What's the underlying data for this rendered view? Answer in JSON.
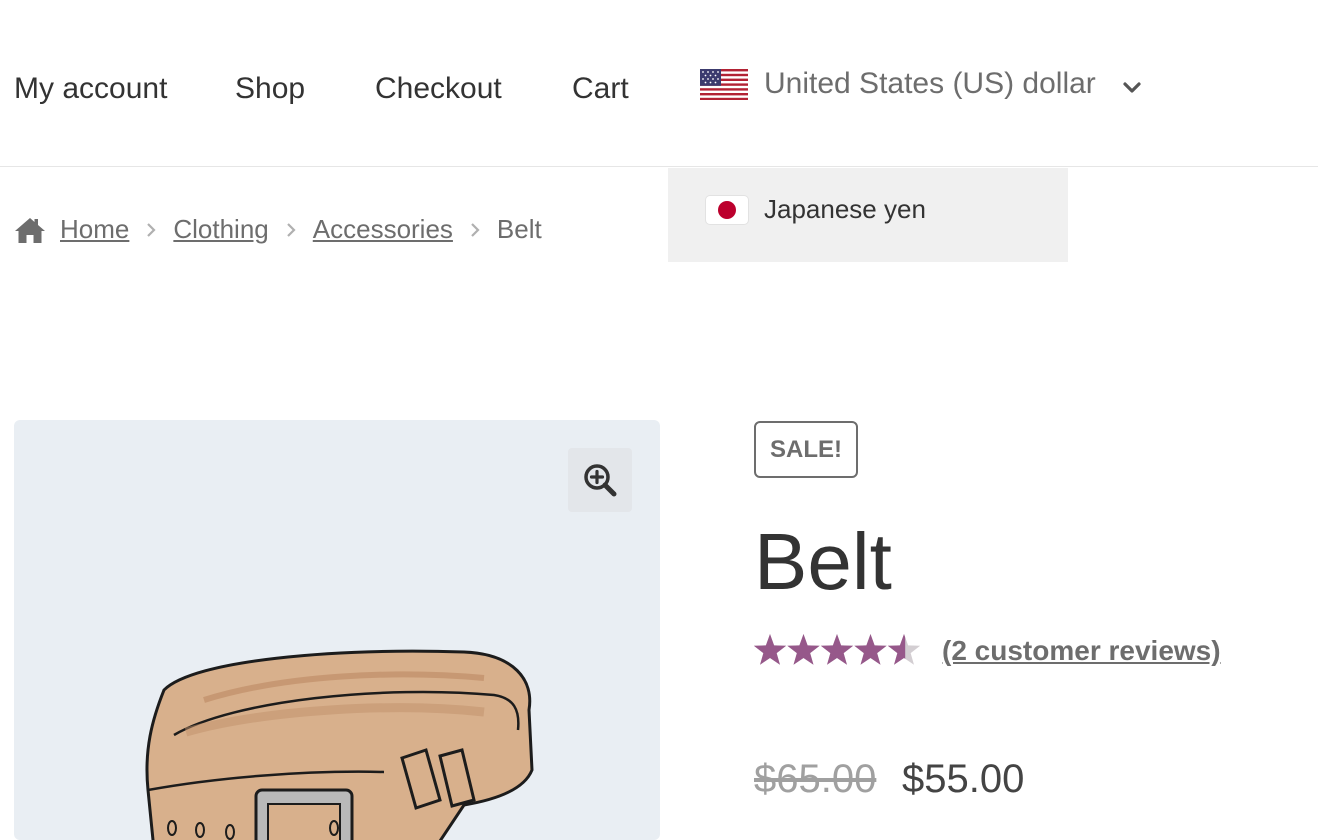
{
  "nav": {
    "links": [
      "My account",
      "Shop",
      "Checkout",
      "Cart"
    ]
  },
  "currency": {
    "selected": "United States (US) dollar",
    "selected_flag": "us-flag-icon",
    "options": [
      {
        "label": "Japanese yen",
        "flag": "jp-flag-icon"
      }
    ]
  },
  "breadcrumb": {
    "home": "Home",
    "category": "Clothing",
    "subcategory": "Accessories",
    "current": "Belt"
  },
  "product": {
    "badge": "SALE!",
    "title": "Belt",
    "rating": 4.5,
    "rating_max": 5,
    "reviews_label": "(2 customer reviews)",
    "regular_price": "$65.00",
    "sale_price": "$55.00"
  },
  "colors": {
    "star": "#96588a",
    "star_empty": "#d3ced2",
    "badge_border": "#6d6d6d",
    "dropdown_bg": "#f0f0f0",
    "gallery_bg": "#e9eef3"
  }
}
